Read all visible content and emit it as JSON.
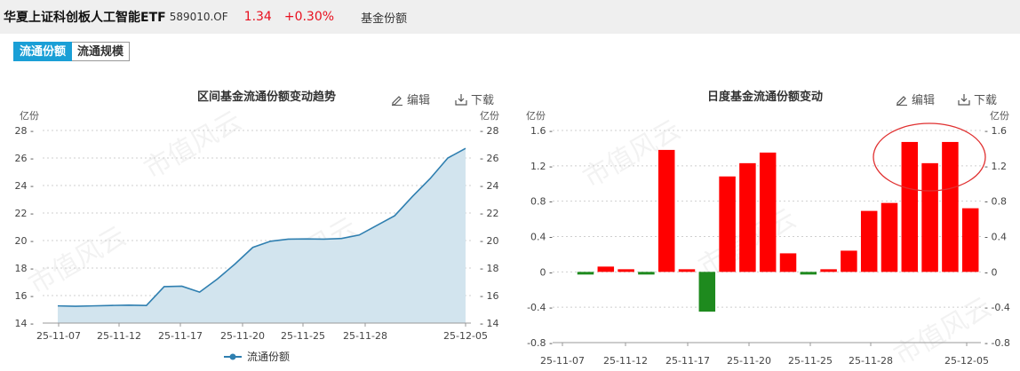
{
  "header": {
    "title": "华夏上证科创板人工智能ETF",
    "code": "589010.OF",
    "price": "1.34",
    "change": "+0.30%",
    "section": "基金份额"
  },
  "tabs": [
    {
      "label": "流通份额",
      "active": true
    },
    {
      "label": "流通规模",
      "active": false
    }
  ],
  "actions": {
    "edit": "编辑",
    "download": "下载"
  },
  "colors": {
    "accent": "#1a9fd6",
    "up": "#ff0000",
    "down": "#1e8a1e",
    "line": "#2f7fb0",
    "area": "#d2e4ee",
    "circle": "#e03030"
  },
  "watermark": "市值风云",
  "chart_data": [
    {
      "type": "area",
      "title": "区间基金流通份额变动趋势",
      "ylabel": "亿份",
      "ylim": [
        14,
        28
      ],
      "yticks": [
        14,
        16,
        18,
        20,
        22,
        24,
        26,
        28
      ],
      "xtick_labels": [
        "25-11-07",
        "25-11-12",
        "25-11-17",
        "25-11-20",
        "25-11-25",
        "25-11-28",
        "25-12-05"
      ],
      "legend": "流通份额",
      "legend_position": "bottom",
      "series": [
        {
          "name": "流通份额",
          "values": [
            15.25,
            15.22,
            15.25,
            15.28,
            15.3,
            15.28,
            16.65,
            16.68,
            16.25,
            17.2,
            18.3,
            19.5,
            19.95,
            20.1,
            20.12,
            20.1,
            20.15,
            20.4,
            21.1,
            21.8,
            23.2,
            24.5,
            26.0,
            26.7
          ]
        }
      ],
      "grid": true
    },
    {
      "type": "bar",
      "title": "日度基金流通份额变动",
      "ylabel": "亿份",
      "ylim": [
        -0.8,
        1.6
      ],
      "yticks": [
        -0.8,
        -0.4,
        0,
        0.4,
        0.8,
        1.2,
        1.6
      ],
      "xtick_labels": [
        "25-11-07",
        "25-11-12",
        "25-11-17",
        "25-11-20",
        "25-11-25",
        "25-11-28",
        "25-12-05"
      ],
      "values": [
        -0.03,
        0.06,
        0.03,
        -0.03,
        1.38,
        0.03,
        -0.45,
        1.08,
        1.23,
        1.35,
        0.21,
        -0.03,
        0.03,
        0.24,
        0.69,
        0.78,
        1.47,
        1.23,
        1.47,
        0.72
      ],
      "grid": true
    }
  ]
}
